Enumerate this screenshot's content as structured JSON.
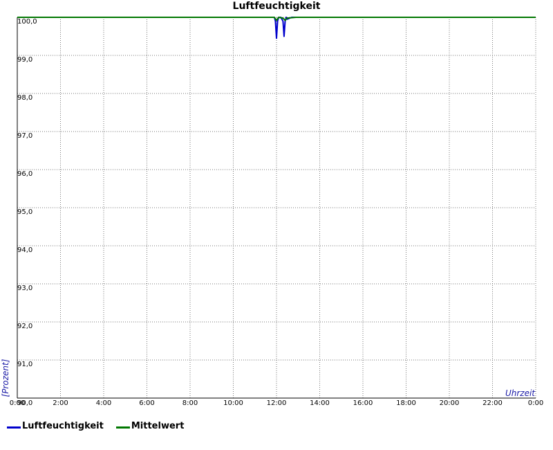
{
  "chart_data": {
    "type": "line",
    "title": "Luftfeuchtigkeit",
    "xlabel": "Uhrzeit",
    "ylabel": "[Prozent]",
    "xlim": [
      0,
      24
    ],
    "ylim": [
      90,
      100
    ],
    "x_ticks": [
      {
        "value": 0,
        "label": "0:00"
      },
      {
        "value": 2,
        "label": "2:00"
      },
      {
        "value": 4,
        "label": "4:00"
      },
      {
        "value": 6,
        "label": "6:00"
      },
      {
        "value": 8,
        "label": "8:00"
      },
      {
        "value": 10,
        "label": "10:00"
      },
      {
        "value": 12,
        "label": "12:00"
      },
      {
        "value": 14,
        "label": "14:00"
      },
      {
        "value": 16,
        "label": "16:00"
      },
      {
        "value": 18,
        "label": "18:00"
      },
      {
        "value": 20,
        "label": "20:00"
      },
      {
        "value": 22,
        "label": "22:00"
      },
      {
        "value": 24,
        "label": "0:00"
      }
    ],
    "y_ticks": [
      {
        "value": 90,
        "label": "90,0"
      },
      {
        "value": 91,
        "label": "91,0"
      },
      {
        "value": 92,
        "label": "92,0"
      },
      {
        "value": 93,
        "label": "93,0"
      },
      {
        "value": 94,
        "label": "94,0"
      },
      {
        "value": 95,
        "label": "95,0"
      },
      {
        "value": 96,
        "label": "96,0"
      },
      {
        "value": 97,
        "label": "97,0"
      },
      {
        "value": 98,
        "label": "98,0"
      },
      {
        "value": 99,
        "label": "99,0"
      },
      {
        "value": 100,
        "label": "100,0"
      }
    ],
    "grid": true,
    "legend_position": "bottom-left",
    "series": [
      {
        "name": "Luftfeuchtigkeit",
        "color": "#0000cc",
        "x": [
          0,
          11.9,
          11.95,
          12.0,
          12.05,
          12.1,
          12.2,
          12.3,
          12.35,
          12.4,
          12.45,
          12.5,
          12.7,
          12.9,
          24
        ],
        "y": [
          100,
          100,
          99.9,
          99.45,
          99.9,
          100,
          100,
          99.9,
          99.5,
          99.9,
          100,
          99.95,
          100,
          100,
          100
        ]
      },
      {
        "name": "Mittelwert",
        "color": "#007700",
        "x": [
          0,
          11.9,
          12.0,
          12.1,
          12.3,
          12.4,
          12.5,
          12.9,
          24
        ],
        "y": [
          100,
          100,
          99.92,
          100,
          99.98,
          99.92,
          99.98,
          100,
          100
        ]
      }
    ]
  }
}
